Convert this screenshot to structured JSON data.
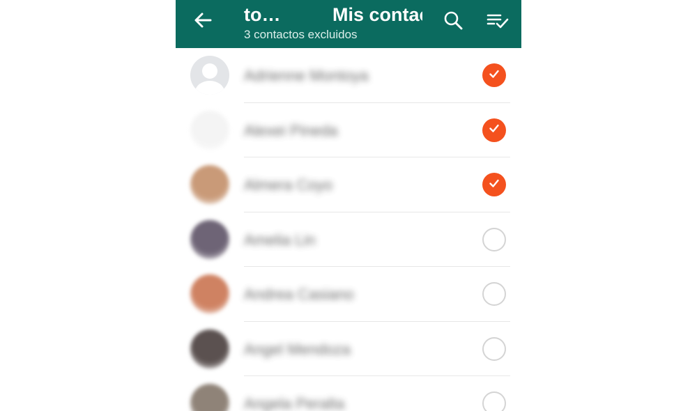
{
  "appbar": {
    "back_icon": "arrow-left-icon",
    "title_left": "to…",
    "title_main": "Mis contactos",
    "subtitle": "3 contactos excluidos",
    "search_icon": "search-icon",
    "select_all_icon": "select-all-icon"
  },
  "colors": {
    "appbar_bg": "#0b6b5f",
    "check_on": "#f4511e",
    "check_off_border": "#d4d4d4"
  },
  "contacts": [
    {
      "name": "Adrienne Montoya",
      "checked": true,
      "avatar": "default"
    },
    {
      "name": "Alexei Pineda",
      "checked": true,
      "avatar": "#f4f4f4"
    },
    {
      "name": "Almera Coyo",
      "checked": true,
      "avatar": "#c99a78"
    },
    {
      "name": "Amelia Lin",
      "checked": false,
      "avatar": "#6e6476"
    },
    {
      "name": "Andrea Casiano",
      "checked": false,
      "avatar": "#cf8262"
    },
    {
      "name": "Angel Mendoza",
      "checked": false,
      "avatar": "#5b5150"
    },
    {
      "name": "Angela Peralta",
      "checked": false,
      "avatar": "#8f8378"
    }
  ]
}
